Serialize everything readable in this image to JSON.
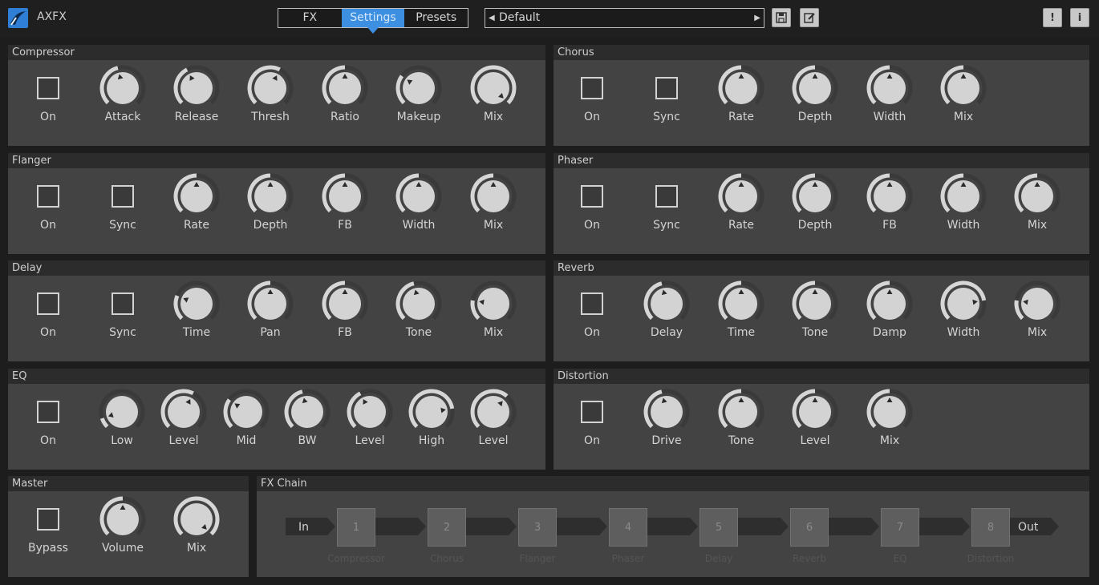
{
  "app": {
    "title": "AXFX",
    "tabs": [
      "FX",
      "Settings",
      "Presets"
    ],
    "active_tab": 1,
    "preset": "Default",
    "accent": "#3d8fe2"
  },
  "icons": {
    "logo": "axfx-logo-icon",
    "save": "save-icon",
    "edit": "edit-icon",
    "warning": "exclamation-icon",
    "info": "info-icon"
  },
  "buttons": {
    "warning": "!",
    "info": "i"
  },
  "panels": [
    {
      "id": "compressor",
      "title": "Compressor",
      "controls": [
        {
          "type": "checkbox",
          "label": "On"
        },
        {
          "type": "knob",
          "label": "Attack",
          "value": 0.45
        },
        {
          "type": "knob",
          "label": "Release",
          "value": 0.4
        },
        {
          "type": "knob",
          "label": "Thresh",
          "value": 0.6
        },
        {
          "type": "knob",
          "label": "Ratio",
          "value": 0.5
        },
        {
          "type": "knob",
          "label": "Makeup",
          "value": 0.3
        },
        {
          "type": "knob",
          "label": "Mix",
          "value": 1.0
        }
      ]
    },
    {
      "id": "chorus",
      "title": "Chorus",
      "controls": [
        {
          "type": "checkbox",
          "label": "On"
        },
        {
          "type": "checkbox",
          "label": "Sync"
        },
        {
          "type": "knob",
          "label": "Rate",
          "value": 0.5
        },
        {
          "type": "knob",
          "label": "Depth",
          "value": 0.5
        },
        {
          "type": "knob",
          "label": "Width",
          "value": 0.5
        },
        {
          "type": "knob",
          "label": "Mix",
          "value": 0.5
        }
      ]
    },
    {
      "id": "flanger",
      "title": "Flanger",
      "controls": [
        {
          "type": "checkbox",
          "label": "On"
        },
        {
          "type": "checkbox",
          "label": "Sync"
        },
        {
          "type": "knob",
          "label": "Rate",
          "value": 0.5
        },
        {
          "type": "knob",
          "label": "Depth",
          "value": 0.5
        },
        {
          "type": "knob",
          "label": "FB",
          "value": 0.5
        },
        {
          "type": "knob",
          "label": "Width",
          "value": 0.5
        },
        {
          "type": "knob",
          "label": "Mix",
          "value": 0.5
        }
      ]
    },
    {
      "id": "phaser",
      "title": "Phaser",
      "controls": [
        {
          "type": "checkbox",
          "label": "On"
        },
        {
          "type": "checkbox",
          "label": "Sync"
        },
        {
          "type": "knob",
          "label": "Rate",
          "value": 0.5
        },
        {
          "type": "knob",
          "label": "Depth",
          "value": 0.5
        },
        {
          "type": "knob",
          "label": "FB",
          "value": 0.5
        },
        {
          "type": "knob",
          "label": "Width",
          "value": 0.5
        },
        {
          "type": "knob",
          "label": "Mix",
          "value": 0.5
        }
      ]
    },
    {
      "id": "delay",
      "title": "Delay",
      "controls": [
        {
          "type": "checkbox",
          "label": "On"
        },
        {
          "type": "checkbox",
          "label": "Sync"
        },
        {
          "type": "knob",
          "label": "Time",
          "value": 0.25
        },
        {
          "type": "knob",
          "label": "Pan",
          "value": 0.5
        },
        {
          "type": "knob",
          "label": "FB",
          "value": 0.5
        },
        {
          "type": "knob",
          "label": "Tone",
          "value": 0.45
        },
        {
          "type": "knob",
          "label": "Mix",
          "value": 0.2
        }
      ]
    },
    {
      "id": "reverb",
      "title": "Reverb",
      "controls": [
        {
          "type": "checkbox",
          "label": "On"
        },
        {
          "type": "knob",
          "label": "Delay",
          "value": 0.45
        },
        {
          "type": "knob",
          "label": "Time",
          "value": 0.5
        },
        {
          "type": "knob",
          "label": "Tone",
          "value": 0.5
        },
        {
          "type": "knob",
          "label": "Damp",
          "value": 0.5
        },
        {
          "type": "knob",
          "label": "Width",
          "value": 0.8
        },
        {
          "type": "knob",
          "label": "Mix",
          "value": 0.2
        }
      ]
    },
    {
      "id": "eq",
      "title": "EQ",
      "controls": [
        {
          "type": "checkbox",
          "label": "On"
        },
        {
          "type": "knob",
          "label": "Low",
          "value": 0.1
        },
        {
          "type": "knob",
          "label": "Level",
          "value": 0.6
        },
        {
          "type": "knob",
          "label": "Mid",
          "value": 0.3
        },
        {
          "type": "knob",
          "label": "BW",
          "value": 0.45
        },
        {
          "type": "knob",
          "label": "Level",
          "value": 0.4
        },
        {
          "type": "knob",
          "label": "High",
          "value": 0.8
        },
        {
          "type": "knob",
          "label": "Level",
          "value": 0.65
        }
      ]
    },
    {
      "id": "distortion",
      "title": "Distortion",
      "controls": [
        {
          "type": "checkbox",
          "label": "On"
        },
        {
          "type": "knob",
          "label": "Drive",
          "value": 0.45
        },
        {
          "type": "knob",
          "label": "Tone",
          "value": 0.5
        },
        {
          "type": "knob",
          "label": "Level",
          "value": 0.5
        },
        {
          "type": "knob",
          "label": "Mix",
          "value": 0.5
        }
      ]
    },
    {
      "id": "master",
      "title": "Master",
      "controls": [
        {
          "type": "checkbox",
          "label": "Bypass"
        },
        {
          "type": "knob",
          "label": "Volume",
          "value": 0.5
        },
        {
          "type": "knob",
          "label": "Mix",
          "value": 1.0
        }
      ]
    }
  ],
  "fx_chain": {
    "title": "FX Chain",
    "in_label": "In",
    "out_label": "Out",
    "slots": [
      {
        "num": "1",
        "name": "Compressor"
      },
      {
        "num": "2",
        "name": "Chorus"
      },
      {
        "num": "3",
        "name": "Flanger"
      },
      {
        "num": "4",
        "name": "Phaser"
      },
      {
        "num": "5",
        "name": "Delay"
      },
      {
        "num": "6",
        "name": "Reverb"
      },
      {
        "num": "7",
        "name": "EQ"
      },
      {
        "num": "8",
        "name": "Distortion"
      }
    ]
  }
}
